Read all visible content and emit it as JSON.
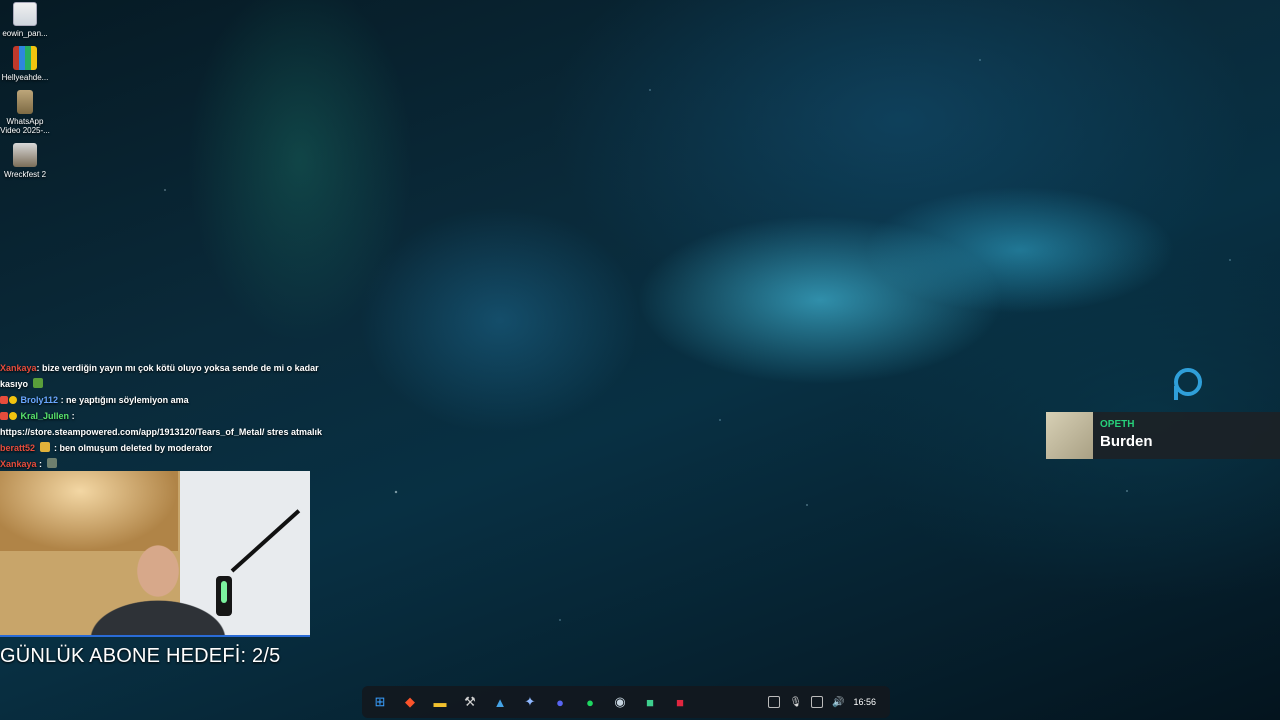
{
  "desktop": {
    "icons": [
      {
        "label": "eowin_pan...",
        "icon": "generic-file-icon"
      },
      {
        "label": "Hellyeahde...",
        "icon": "winrar-icon"
      },
      {
        "label": "WhatsApp Video 2025-...",
        "icon": "video-file-icon"
      },
      {
        "label": "Wreckfest 2",
        "icon": "game-icon"
      }
    ]
  },
  "chat": {
    "lines": [
      {
        "user": "Xankaya",
        "user_color": "#e74c3c",
        "text": ": bize verdiğin yayın mı çok kötü oluyo yoksa sende de mi o kadar"
      },
      {
        "user": "",
        "user_color": "#ffffff",
        "text": "kasıyo"
      },
      {
        "user": "Broly112",
        "user_color": "#6aa7ff",
        "text": ": ne yaptığını söylemiyon ama"
      },
      {
        "user": "Kral_Jullen",
        "user_color": "#58e36b",
        "text": ":"
      },
      {
        "user": "",
        "user_color": "#ffffff",
        "text": "https://store.steampowered.com/app/1913120/Tears_of_Metal/ stres atmalık"
      },
      {
        "user": "beratt52",
        "user_color": "#e74c3c",
        "text": ": ben olmuşum deleted by moderator"
      },
      {
        "user": "Xankaya",
        "user_color": "#e74c3c",
        "text": ":"
      }
    ]
  },
  "goal": {
    "text": "GÜNLÜK ABONE HEDEFİ: 2/5"
  },
  "music": {
    "artist": "OPETH",
    "song": "Burden",
    "artist_color": "#27d07a"
  },
  "taskbar": {
    "apps": [
      {
        "name": "windows-start-icon",
        "glyph": "⊞",
        "color": "#3aa0ff"
      },
      {
        "name": "brave-browser-icon",
        "glyph": "◆",
        "color": "#fb542b"
      },
      {
        "name": "file-explorer-icon",
        "glyph": "▬",
        "color": "#f2c12e"
      },
      {
        "name": "hammer-tool-icon",
        "glyph": "⚒",
        "color": "#d0d0d0"
      },
      {
        "name": "photos-icon",
        "glyph": "▲",
        "color": "#45a3e6"
      },
      {
        "name": "settings-gear-icon",
        "glyph": "✦",
        "color": "#8fb8ff"
      },
      {
        "name": "discord-icon",
        "glyph": "●",
        "color": "#5865f2"
      },
      {
        "name": "spotify-icon",
        "glyph": "●",
        "color": "#1ed760"
      },
      {
        "name": "steam-icon",
        "glyph": "◉",
        "color": "#c7d5e0"
      },
      {
        "name": "chat-app-icon",
        "glyph": "■",
        "color": "#3ecf8e"
      },
      {
        "name": "media-app-icon",
        "glyph": "■",
        "color": "#e0263f"
      }
    ],
    "tray": {
      "clock": "16:56"
    }
  }
}
